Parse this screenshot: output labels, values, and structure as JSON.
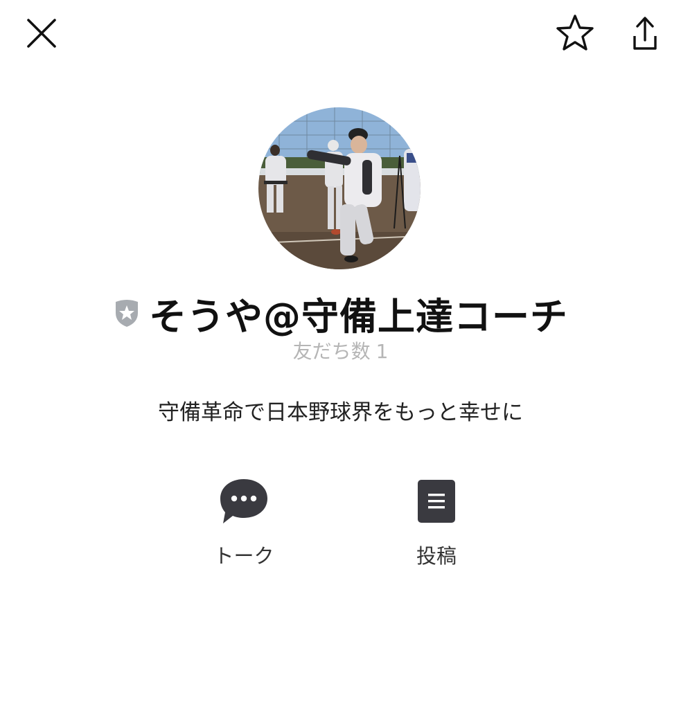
{
  "header": {
    "close_icon": "close-icon",
    "favorite_icon": "star-icon",
    "share_icon": "share-icon"
  },
  "profile": {
    "avatar_description_icon": "profile-photo",
    "badge_icon": "shield-star-icon",
    "badge_color": "#a7abb0",
    "name": "そうや@守備上達コーチ",
    "friends_label": "友だち数",
    "friends_count": "1",
    "status_message": "守備革命で日本野球界をもっと幸せに"
  },
  "actions": [
    {
      "label": "トーク",
      "icon": "chat-bubble-icon"
    },
    {
      "label": "投稿",
      "icon": "post-list-icon"
    }
  ],
  "colors": {
    "icon_dark": "#3a3a40",
    "text_primary": "#111111",
    "text_muted": "#b5b5b5"
  }
}
